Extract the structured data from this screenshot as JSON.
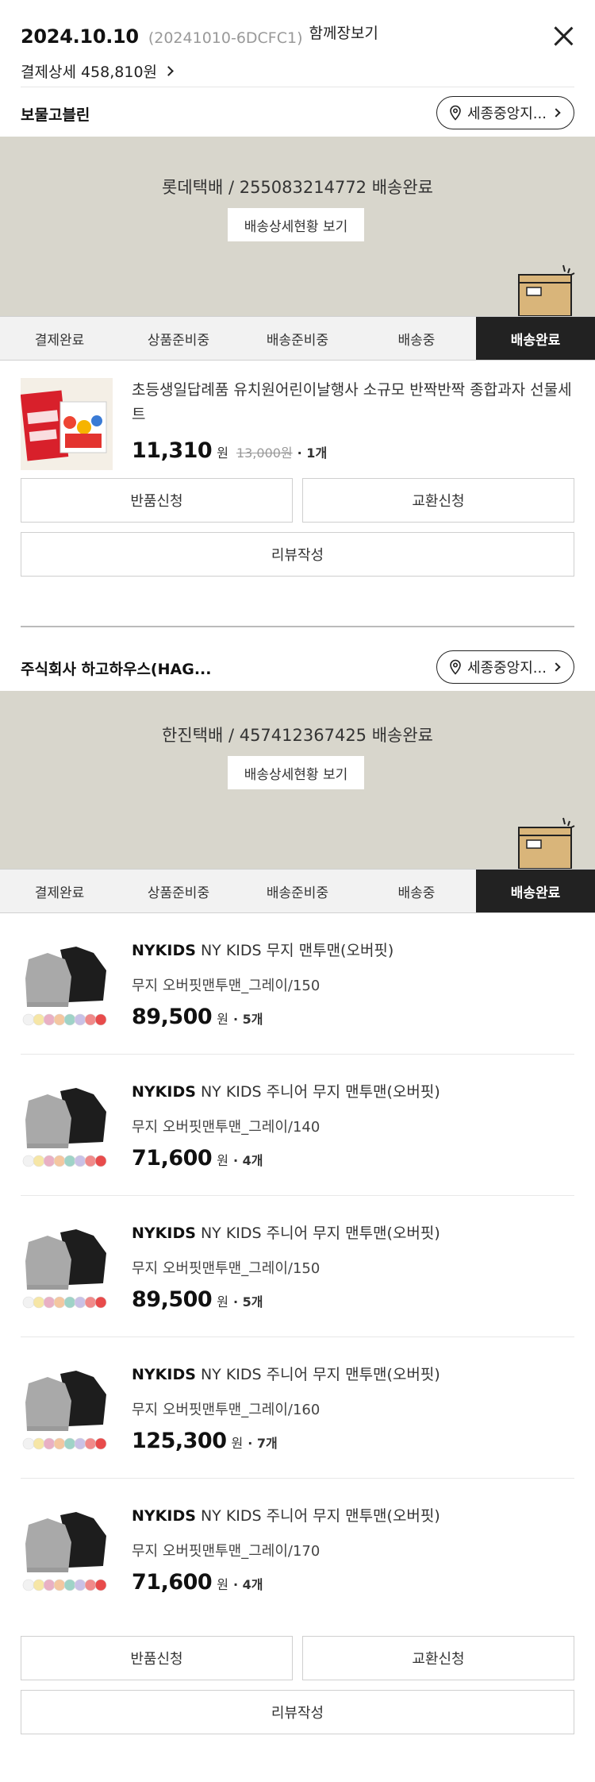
{
  "header": {
    "date": "2024.10.10",
    "order_code": "(20241010-6DCFC1)",
    "cart_link": "함께장보기",
    "payment_detail": "결제상세 458,810원"
  },
  "steps": [
    "결제완료",
    "상품준비중",
    "배송준비중",
    "배송중",
    "배송완료"
  ],
  "shipments": [
    {
      "shop_name": "보물고블린",
      "location": "세종중앙지...",
      "ship_text": "롯데택배 / 255083214772 배송완료",
      "detail_button": "배송상세현황 보기",
      "items": [
        {
          "brand": "",
          "title": "초등생일답례품 유치원어린이날행사 소규모 반짝반짝 종합과자 선물세트",
          "option": "",
          "price": "11,310",
          "won": "원",
          "original": "13,000원",
          "qty": "· 1개"
        }
      ],
      "buttons": {
        "return": "반품신청",
        "exchange": "교환신청",
        "review": "리뷰작성"
      }
    },
    {
      "shop_name": "주식회사 하고하우스(HAG...",
      "location": "세종중앙지...",
      "ship_text": "한진택배 / 457412367425 배송완료",
      "detail_button": "배송상세현황 보기",
      "items": [
        {
          "brand": "NYKIDS",
          "title": "NY KIDS 무지 맨투맨(오버핏)",
          "option": "무지 오버핏맨투맨_그레이/150",
          "price": "89,500",
          "won": "원",
          "qty": "· 5개"
        },
        {
          "brand": "NYKIDS",
          "title": "NY KIDS 주니어 무지 맨투맨(오버핏)",
          "option": "무지 오버핏맨투맨_그레이/140",
          "price": "71,600",
          "won": "원",
          "qty": "· 4개"
        },
        {
          "brand": "NYKIDS",
          "title": "NY KIDS 주니어 무지 맨투맨(오버핏)",
          "option": "무지 오버핏맨투맨_그레이/150",
          "price": "89,500",
          "won": "원",
          "qty": "· 5개"
        },
        {
          "brand": "NYKIDS",
          "title": "NY KIDS 주니어 무지 맨투맨(오버핏)",
          "option": "무지 오버핏맨투맨_그레이/160",
          "price": "125,300",
          "won": "원",
          "qty": "· 7개"
        },
        {
          "brand": "NYKIDS",
          "title": "NY KIDS 주니어 무지 맨투맨(오버핏)",
          "option": "무지 오버핏맨투맨_그레이/170",
          "price": "71,600",
          "won": "원",
          "qty": "· 4개"
        }
      ],
      "buttons": {
        "return": "반품신청",
        "exchange": "교환신청",
        "review": "리뷰작성"
      }
    }
  ],
  "colors": {
    "banner": "#d8d6cc",
    "active_step": "#222222",
    "box": "#d9b57a"
  }
}
